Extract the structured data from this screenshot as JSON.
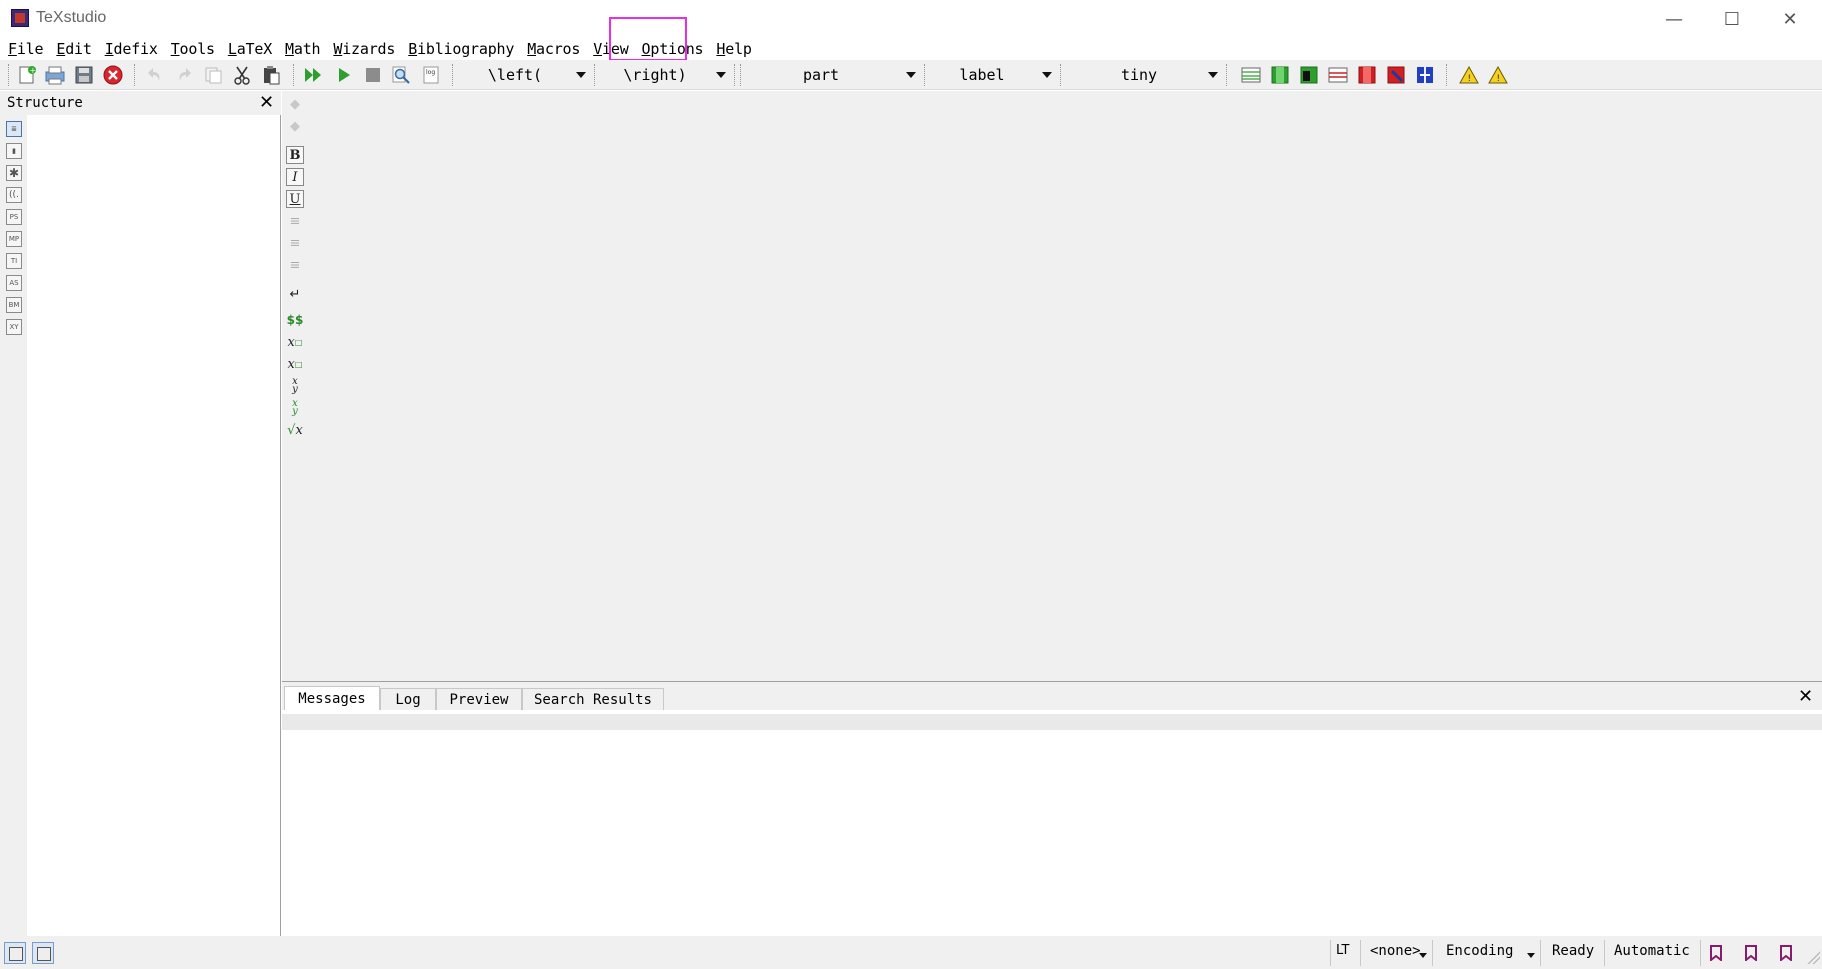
{
  "window": {
    "title": "TeXstudio",
    "controls": {
      "minimize": "—",
      "maximize": "☐",
      "close": "✕"
    }
  },
  "menu": [
    {
      "label": "File"
    },
    {
      "label": "Edit"
    },
    {
      "label": "Idefix"
    },
    {
      "label": "Tools"
    },
    {
      "label": "LaTeX"
    },
    {
      "label": "Math"
    },
    {
      "label": "Wizards"
    },
    {
      "label": "Bibliography"
    },
    {
      "label": "Macros"
    },
    {
      "label": "View"
    },
    {
      "label": "Options"
    },
    {
      "label": "Help"
    }
  ],
  "toolbar": {
    "icons": [
      "new-file-icon",
      "print-icon",
      "save-icon",
      "close-file-icon",
      "undo-icon",
      "redo-icon",
      "copy-icon",
      "cut-icon",
      "paste-icon",
      "build-view-icon",
      "compile-icon",
      "stop-icon",
      "view-icon",
      "log-icon"
    ],
    "combos": {
      "left_delim": "\\left(",
      "right_delim": "\\right)",
      "sectioning": "part",
      "reference": "label",
      "size": "tiny"
    },
    "table_icons": [
      "table-icon",
      "add-column-icon",
      "insert-column-icon",
      "add-row-icon",
      "remove-column-icon",
      "remove-row-icon",
      "align-table-icon"
    ],
    "warning_icons": [
      "warning-icon",
      "warning-alt-icon"
    ]
  },
  "structure": {
    "title": "Structure",
    "close": "✕",
    "sidebar_icons": [
      "structure-icon",
      "bookmark-icon",
      "symbols-icon",
      "left-right-icon",
      "pstricks-icon",
      "metapost-icon",
      "tikz-icon",
      "asymptote-icon",
      "beamer-icon",
      "xypic-icon"
    ]
  },
  "editor": {
    "format_icons": {
      "bold": "B",
      "italic": "I",
      "underline": "U",
      "math": "$$"
    }
  },
  "messages_panel": {
    "tabs": [
      {
        "label": "Messages"
      },
      {
        "label": "Log"
      },
      {
        "label": "Preview"
      },
      {
        "label": "Search Results"
      }
    ],
    "active_tab": "Messages",
    "close": "✕"
  },
  "statusbar": {
    "language": "<none>",
    "encoding": "Encoding",
    "status": "Ready",
    "mode": "Automatic"
  },
  "colors": {
    "highlight": "#e62ee6",
    "panel_bg": "#f0f0f0",
    "bookmark": "#8a1a6a"
  }
}
